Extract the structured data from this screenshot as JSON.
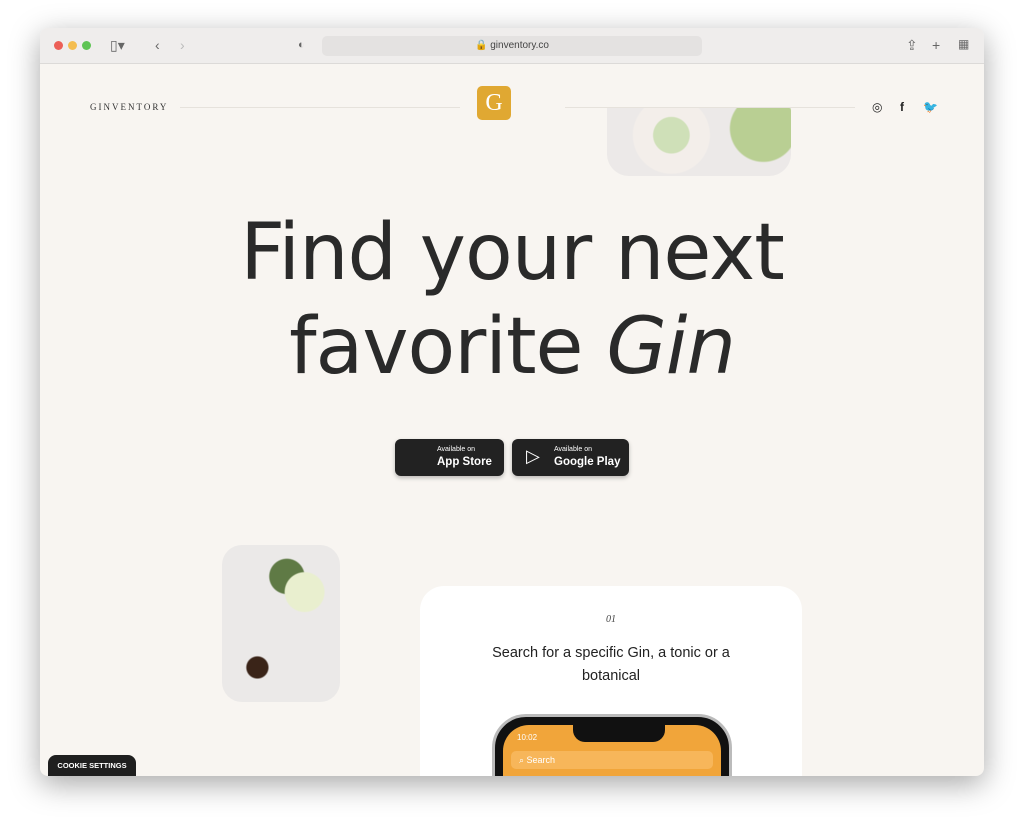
{
  "browser": {
    "url": "ginventory.co"
  },
  "header": {
    "brand": "GINVENTORY",
    "logo_letter": "G"
  },
  "hero": {
    "line1": "Find your next",
    "line2_prefix": "favorite ",
    "line2_italic": "Gin"
  },
  "stores": [
    {
      "small": "Available on",
      "label": "App Store",
      "icon": "apple-icon"
    },
    {
      "small": "Available on",
      "label": "Google Play",
      "icon": "play-icon"
    }
  ],
  "step": {
    "number": "01",
    "text": "Search for a specific Gin, a tonic or a botanical"
  },
  "phone": {
    "time": "10:02",
    "search_placeholder": "Search"
  },
  "cookie": {
    "label": "COOKIE SETTINGS"
  },
  "colors": {
    "background": "#f8f5f1",
    "logo": "#e0a832",
    "phone_screen": "#f1a53a"
  }
}
